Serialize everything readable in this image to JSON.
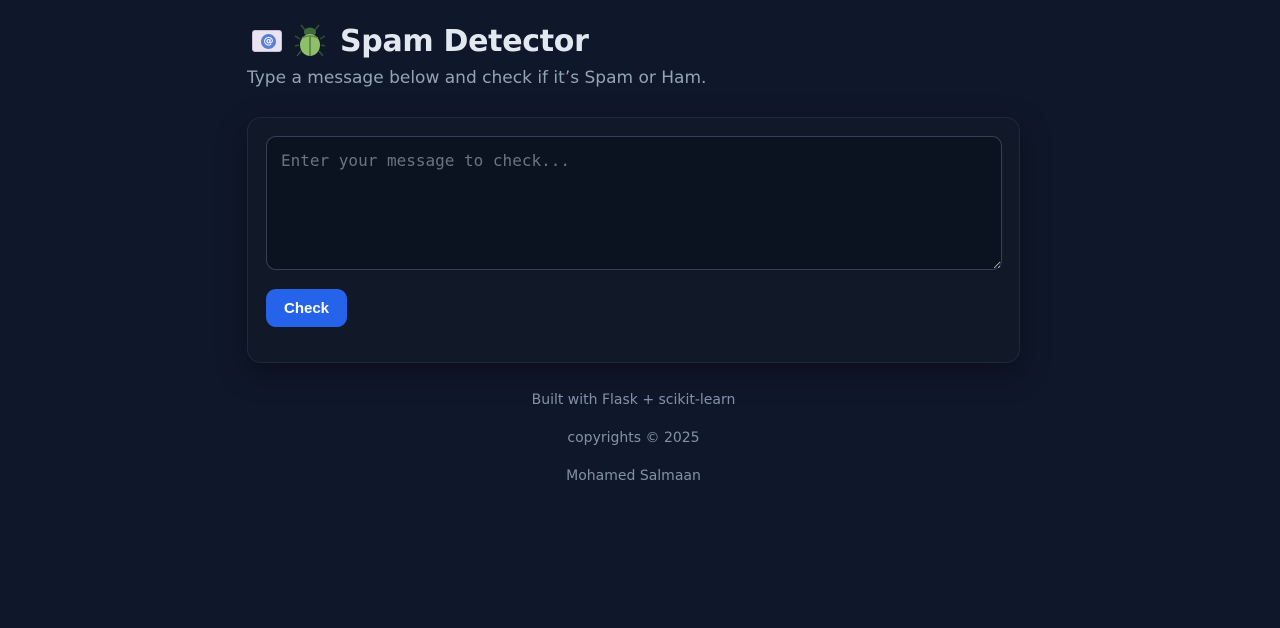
{
  "header": {
    "icons": [
      "email-icon",
      "bug-icon"
    ],
    "title": "Spam Detector",
    "subtitle": "Type a message below and check if it’s Spam or Ham."
  },
  "form": {
    "message_placeholder": "Enter your message to check...",
    "message_value": "",
    "check_label": "Check"
  },
  "footer": {
    "built_with": "Built with Flask + scikit-learn",
    "copyright": "copyrights © 2025",
    "author": "Mohamed Salmaan"
  },
  "colors": {
    "background": "#0f172a",
    "card": "#111827",
    "accent": "#2563eb"
  }
}
